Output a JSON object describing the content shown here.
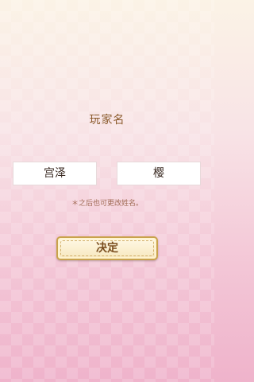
{
  "screen": {
    "title": "玩家名",
    "family_name": "宫泽",
    "given_name": "樱",
    "note": "＊之后也可更改姓名。",
    "confirm_label": "决定"
  }
}
